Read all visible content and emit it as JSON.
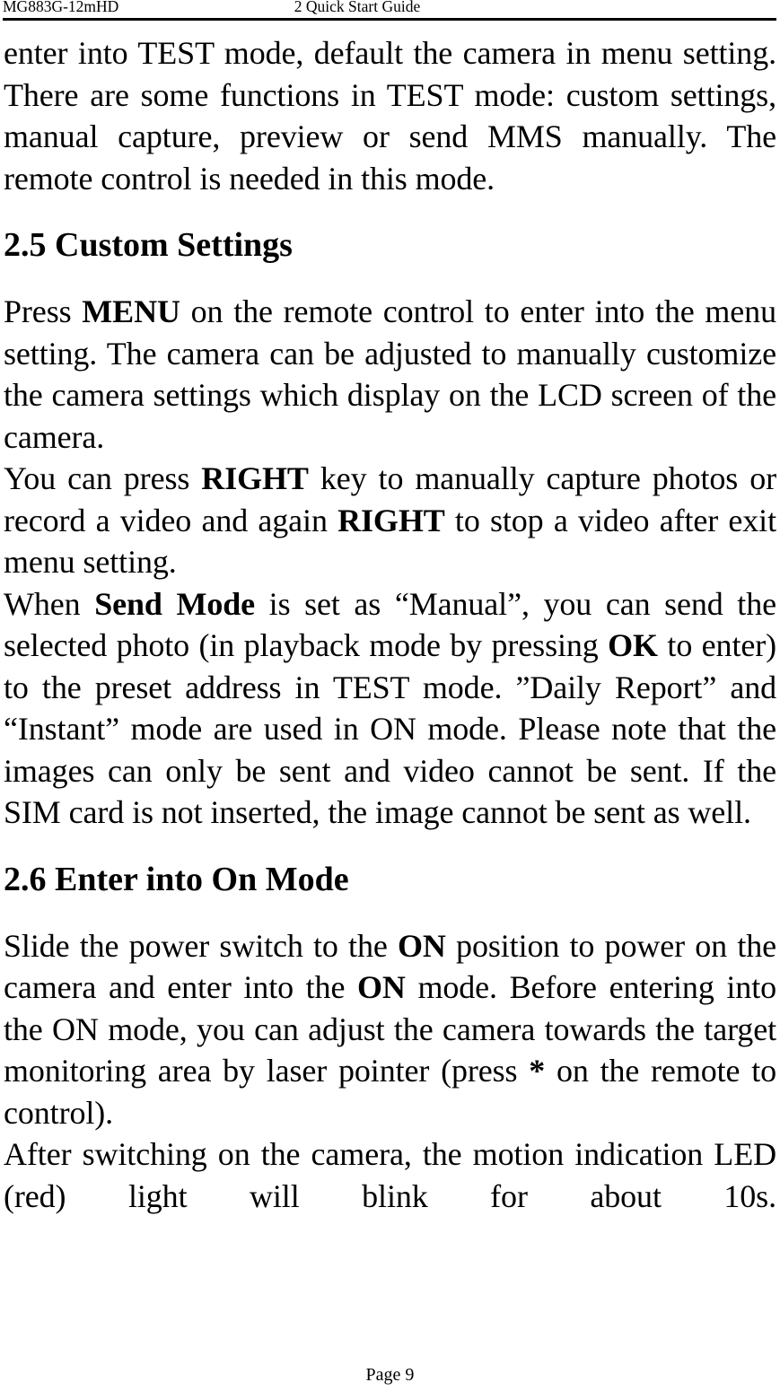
{
  "header": {
    "left_text": "MG883G-12mHD",
    "center_text": "2 Quick Start Guide"
  },
  "footer": {
    "page_label": "Page 9"
  },
  "content": {
    "intro_paragraph": {
      "text": "enter into TEST mode, default the camera in menu setting. There are some functions in TEST mode: custom settings, manual capture, preview or send MMS manually. The remote control is needed in this mode."
    },
    "section_2_5": {
      "heading": "2.5 Custom Settings",
      "para_1": {
        "run_1": "Press ",
        "bold_1": "MENU",
        "run_2": " on the remote control to enter into the menu setting. The camera can be adjusted to manually customize the camera settings which display on the LCD screen of the camera."
      },
      "para_2": {
        "run_1": "You can press ",
        "bold_1": "RIGHT",
        "run_2": " key to manually capture photos or record a video and again ",
        "bold_2": "RIGHT",
        "run_3": " to stop a video after exit menu setting."
      },
      "para_3": {
        "run_1": "When ",
        "bold_1": "Send Mode",
        "run_2": " is set as “Manual”, you can send the selected photo (in playback mode by pressing ",
        "bold_2": "OK",
        "run_3": " to enter) to the preset address in TEST mode. ”Daily Report” and “Instant” mode are used in ON mode. Please note that the images can only be sent and video cannot be sent. If the SIM card is not inserted, the image cannot be sent as well."
      }
    },
    "section_2_6": {
      "heading": "2.6 Enter into On Mode",
      "para_1": {
        "run_1": "Slide the power switch to the ",
        "bold_1": "ON",
        "run_2": " position to power on the camera and enter into the ",
        "bold_2": "ON",
        "run_3": " mode. Before entering into the ON mode, you can adjust the camera towards the target monitoring area by laser pointer (press ",
        "bold_3": "*",
        "run_4": " on the remote to control)."
      },
      "para_2": {
        "run_1": "After switching on the camera, the motion indication LED (red) light will blink for about 10s."
      }
    }
  }
}
